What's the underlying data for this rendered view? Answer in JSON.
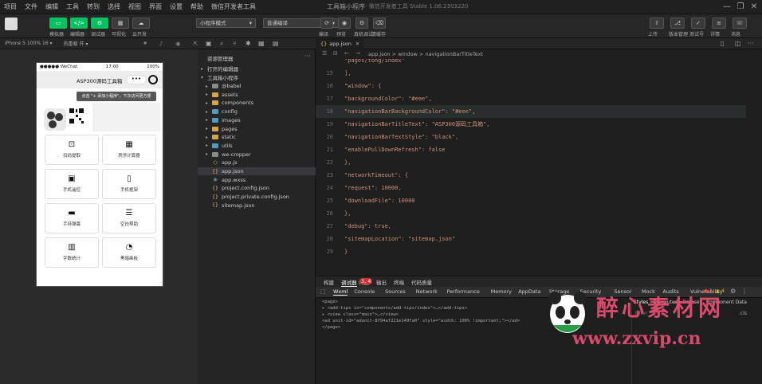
{
  "window": {
    "title": "工具箱小程序",
    "subtitle": "- 微信开发者工具 Stable 1.06.2303220",
    "minimize_label": "—",
    "maximize_label": "❐",
    "close_label": "✕"
  },
  "menubar": {
    "items": [
      "项目",
      "文件",
      "编辑",
      "工具",
      "转到",
      "选择",
      "视图",
      "界面",
      "设置",
      "帮助",
      "微信开发者工具"
    ]
  },
  "toolbar": {
    "avatar_label": "",
    "buttons": [
      {
        "label": "模拟器",
        "icon": "phone-icon"
      },
      {
        "label": "编辑器",
        "icon": "code-icon"
      },
      {
        "label": "调试器",
        "icon": "debug-icon"
      },
      {
        "label": "可视化",
        "icon": "grid-icon"
      },
      {
        "label": "云开发",
        "icon": "cloud-icon"
      }
    ],
    "mode_select": "小程序模式",
    "compile_select": "普通编译",
    "right_buttons": [
      {
        "label": "编译"
      },
      {
        "label": "预览"
      },
      {
        "label": "真机调试"
      },
      {
        "label": "清缓存"
      }
    ],
    "far_right_buttons": [
      {
        "label": "上传"
      },
      {
        "label": "版本管理"
      },
      {
        "label": "测试号"
      },
      {
        "label": "详情"
      },
      {
        "label": "消息"
      }
    ]
  },
  "simulator": {
    "device": "iPhone 5 100% 16 ▾",
    "hotreload": "热重载 开 ▾",
    "statusbar": {
      "carrier": "●●●●● WeChat",
      "time": "17:00",
      "battery": "100%"
    },
    "nav_title": "ASP300源码工具箱",
    "tip": "点击 \"+ 添加小程序\"，下次访问更方便",
    "cards": [
      {
        "label": "扫码提取",
        "icon": "scan-icon"
      },
      {
        "label": "房贷计算器",
        "icon": "calculator-icon"
      },
      {
        "label": "手机遥控",
        "icon": "remote-icon"
      },
      {
        "label": "手机框架",
        "icon": "phone-frame-icon"
      },
      {
        "label": "手持弹幕",
        "icon": "barrage-icon"
      },
      {
        "label": "空白帮助",
        "icon": "note-icon"
      },
      {
        "label": "字数统计",
        "icon": "count-icon"
      },
      {
        "label": "黑暗画板",
        "icon": "palette-icon"
      }
    ]
  },
  "explorer": {
    "title": "资源管理器",
    "section_open": "打开的编辑器",
    "section_project": "工具箱小程序",
    "tree": [
      {
        "name": "@babel",
        "type": "folder",
        "color": "gray"
      },
      {
        "name": "assets",
        "type": "folder",
        "color": "orange"
      },
      {
        "name": "components",
        "type": "folder",
        "color": "orange"
      },
      {
        "name": "config",
        "type": "folder",
        "color": "blue"
      },
      {
        "name": "images",
        "type": "folder",
        "color": "blue"
      },
      {
        "name": "pages",
        "type": "folder",
        "color": "orange"
      },
      {
        "name": "static",
        "type": "folder",
        "color": "orange"
      },
      {
        "name": "utils",
        "type": "folder",
        "color": "blue"
      },
      {
        "name": "we-cropper",
        "type": "folder",
        "color": "gray"
      },
      {
        "name": "app.js",
        "type": "js"
      },
      {
        "name": "app.json",
        "type": "json",
        "selected": true
      },
      {
        "name": "app.wxss",
        "type": "wxss"
      },
      {
        "name": "project.config.json",
        "type": "json"
      },
      {
        "name": "project.private.config.json",
        "type": "json"
      },
      {
        "name": "sitemap.json",
        "type": "json"
      }
    ]
  },
  "editor": {
    "tab": "app.json",
    "breadcrumb": [
      "app.json",
      "window",
      "navigationBarTitleText"
    ],
    "lines": [
      {
        "n": "",
        "text": "  \"pages/tong/index\"",
        "cls": "str"
      },
      {
        "n": "15",
        "text": "],"
      },
      {
        "n": "16",
        "text": "\"window\": {"
      },
      {
        "n": "17",
        "text": "  \"backgroundColor\": \"#eee\","
      },
      {
        "n": "18",
        "text": "  \"navigationBarBackgroundColor\": \"#eee\","
      },
      {
        "n": "19",
        "text": "  \"navigationBarTitleText\": \"ASP300源码工具箱\","
      },
      {
        "n": "20",
        "text": "  \"navigationBarTextStyle\": \"black\","
      },
      {
        "n": "21",
        "text": "  \"enablePullDownRefresh\": false"
      },
      {
        "n": "22",
        "text": "},"
      },
      {
        "n": "23",
        "text": "\"networkTimeout\": {"
      },
      {
        "n": "24",
        "text": "  \"request\": 10000,"
      },
      {
        "n": "25",
        "text": "  \"downloadFile\": 10000"
      },
      {
        "n": "26",
        "text": "},"
      },
      {
        "n": "27",
        "text": "\"debug\": true,"
      },
      {
        "n": "28",
        "text": "\"sitemapLocation\": \"sitemap.json\""
      },
      {
        "n": "29",
        "text": "}"
      }
    ]
  },
  "devtools": {
    "top_tabs": [
      "构建",
      "调试器",
      "问题",
      "输出",
      "终端",
      "代码质量"
    ],
    "badge": "3, 4",
    "tabs": [
      "Wxml",
      "Console",
      "Sources",
      "Network",
      "Performance",
      "Memory",
      "AppData",
      "Storage",
      "Security",
      "Sensor",
      "Mock",
      "Audits",
      "Vulnerability"
    ],
    "errors": "3",
    "warnings": "4",
    "side_tabs": [
      "Styles",
      "Computed",
      "Dataset",
      "Component Data"
    ],
    "filter": "Filter",
    "cls": ".cls",
    "wxml": [
      "<page>",
      "  ▸ <add-tips is=\"components/add-tips/index\">…</add-tips>",
      "  ▸ <view class=\"main\">…</view>",
      "    <ad unit-id=\"adunit-8f94af221e149fa0\" style=\"width: 100% !important;\"></ad>",
      "</page>"
    ]
  },
  "watermark": {
    "text": "醉心素材网",
    "url": "www.zxvip.cn"
  }
}
